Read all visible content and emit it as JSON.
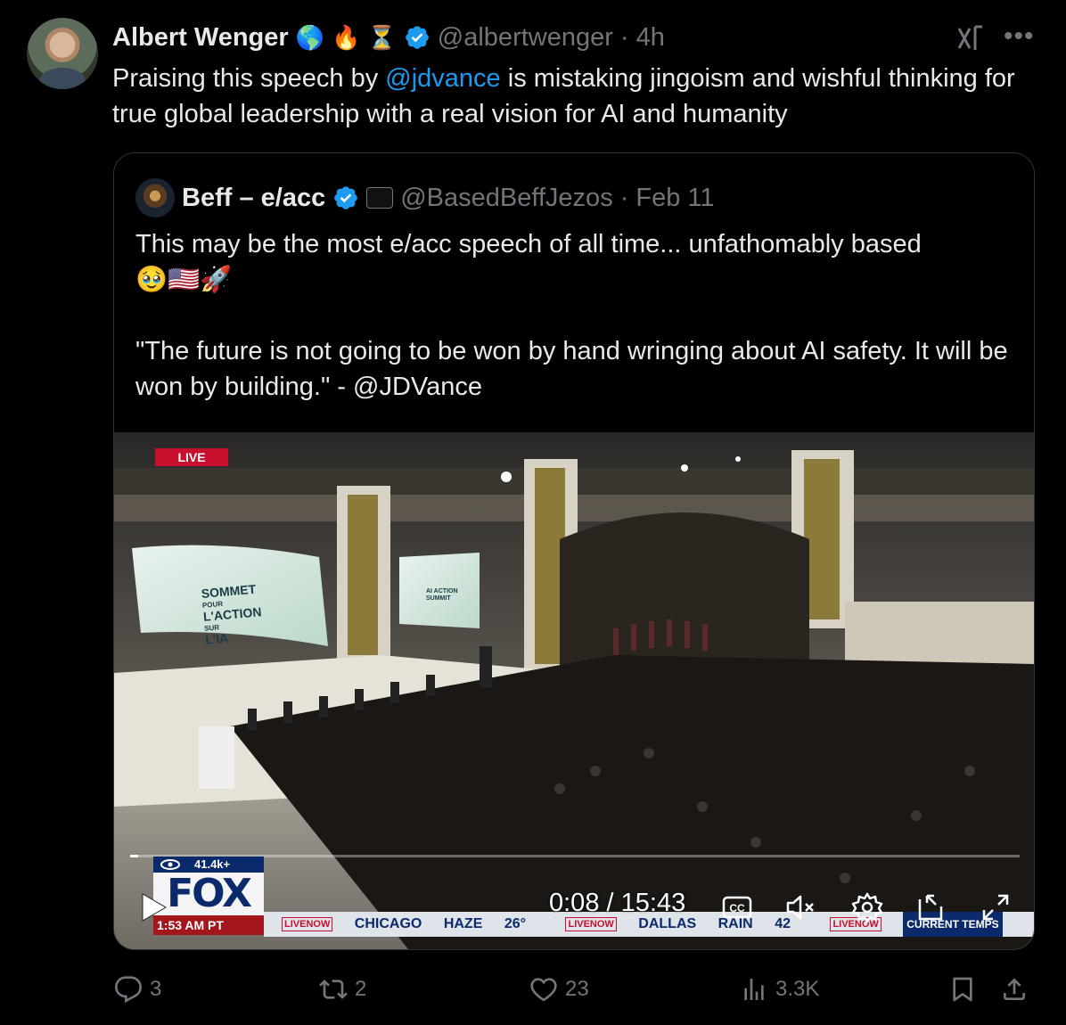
{
  "tweet": {
    "author_name": "Albert Wenger",
    "author_emojis": [
      "🌎",
      "🔥",
      "⏳"
    ],
    "handle": "@albertwenger",
    "separator": "·",
    "time": "4h",
    "text_before": "Praising this speech by ",
    "mention": "@jdvance",
    "text_after": " is mistaking jingoism and wishful thinking for true global leadership with a real vision for AI and humanity"
  },
  "quote": {
    "author_name": "Beff – e/acc",
    "handle": "@BasedBeffJezos",
    "separator": "·",
    "date": "Feb 11",
    "text_line1": "This may be the most e/acc speech of all time... unfathomably based",
    "emojis": "🥹🇺🇸🚀",
    "text_quote": "\"The future is not going to be won by hand wringing about AI safety. It will be won by building.\" - @JDVance"
  },
  "video": {
    "live_label": "LIVE",
    "screen_text_line1": "SOMMET",
    "screen_text_line2": "POUR",
    "screen_text_line3": "L'ACTION",
    "screen_text_line4": "SUR",
    "screen_text_line5": "L'IA",
    "screen2_line1": "AI ACTION",
    "screen2_line2": "SUMMIT",
    "views": "41.4k+",
    "network": "FOX",
    "broadcast_time": "1:53 AM PT",
    "ticker": {
      "live_now": "LIVENOW",
      "city1": "CHICAGO",
      "weather1": "HAZE",
      "temp1": "26°",
      "city2": "DALLAS",
      "weather2": "RAIN",
      "temp2": "42",
      "current_temps": "CURRENT TEMPS"
    },
    "time_current": "0:08",
    "time_sep": " / ",
    "time_total": "15:43",
    "progress_fraction": 0.009
  },
  "actions": {
    "replies": "3",
    "reposts": "2",
    "likes": "23",
    "views": "3.3K"
  },
  "colors": {
    "accent": "#1d9bf0",
    "muted": "#71767b",
    "text": "#e7e9ea",
    "border": "#2f3336"
  }
}
